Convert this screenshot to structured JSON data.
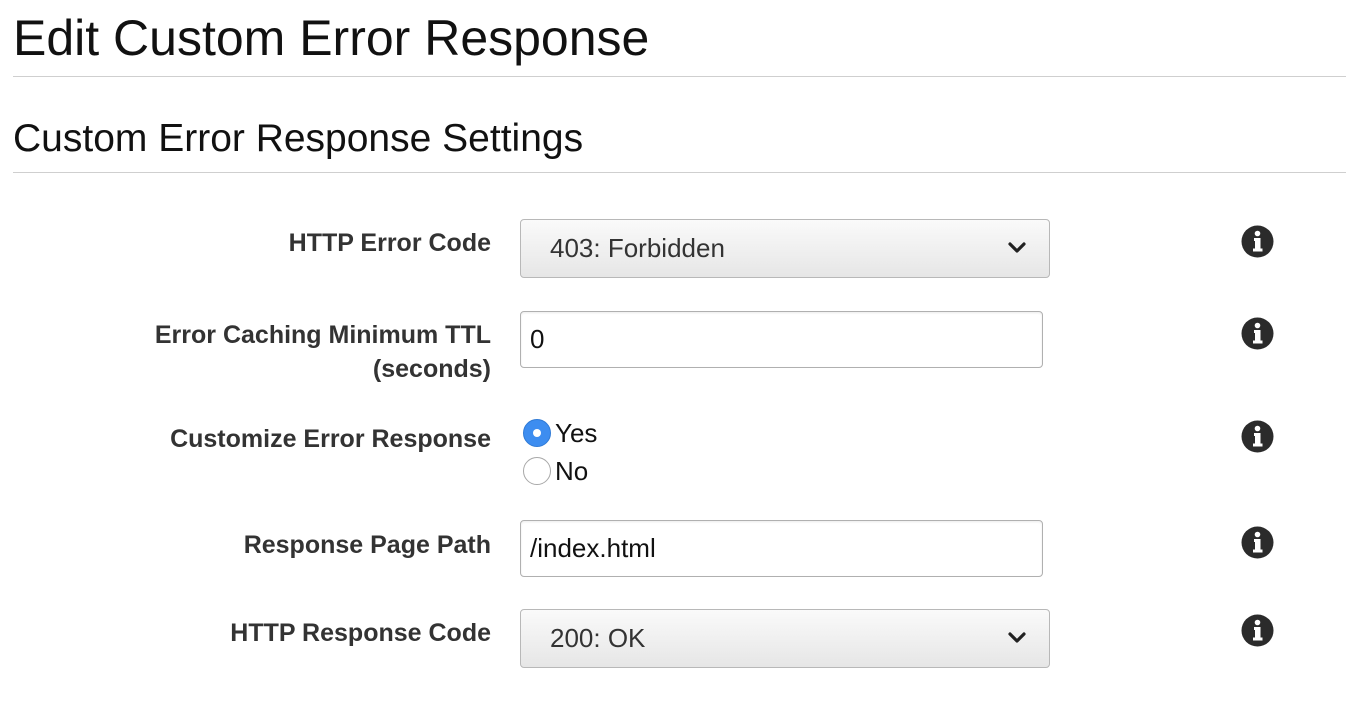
{
  "page": {
    "title": "Edit Custom Error Response",
    "section_title": "Custom Error Response Settings"
  },
  "form": {
    "http_error_code": {
      "label": "HTTP Error Code",
      "value": "403: Forbidden"
    },
    "error_caching_min_ttl": {
      "label_line1": "Error Caching Minimum TTL",
      "label_line2": "(seconds)",
      "value": "0"
    },
    "customize_error_response": {
      "label": "Customize Error Response",
      "options": [
        "Yes",
        "No"
      ],
      "selected": "Yes"
    },
    "response_page_path": {
      "label": "Response Page Path",
      "value": "/index.html"
    },
    "http_response_code": {
      "label": "HTTP Response Code",
      "value": "200: OK"
    }
  },
  "icons": {
    "info": "info-icon",
    "dropdown": "chevron-down-icon"
  },
  "colors": {
    "radio_selected": "#3d8df0",
    "label_text": "#333333",
    "divider": "#cfcfcf"
  }
}
